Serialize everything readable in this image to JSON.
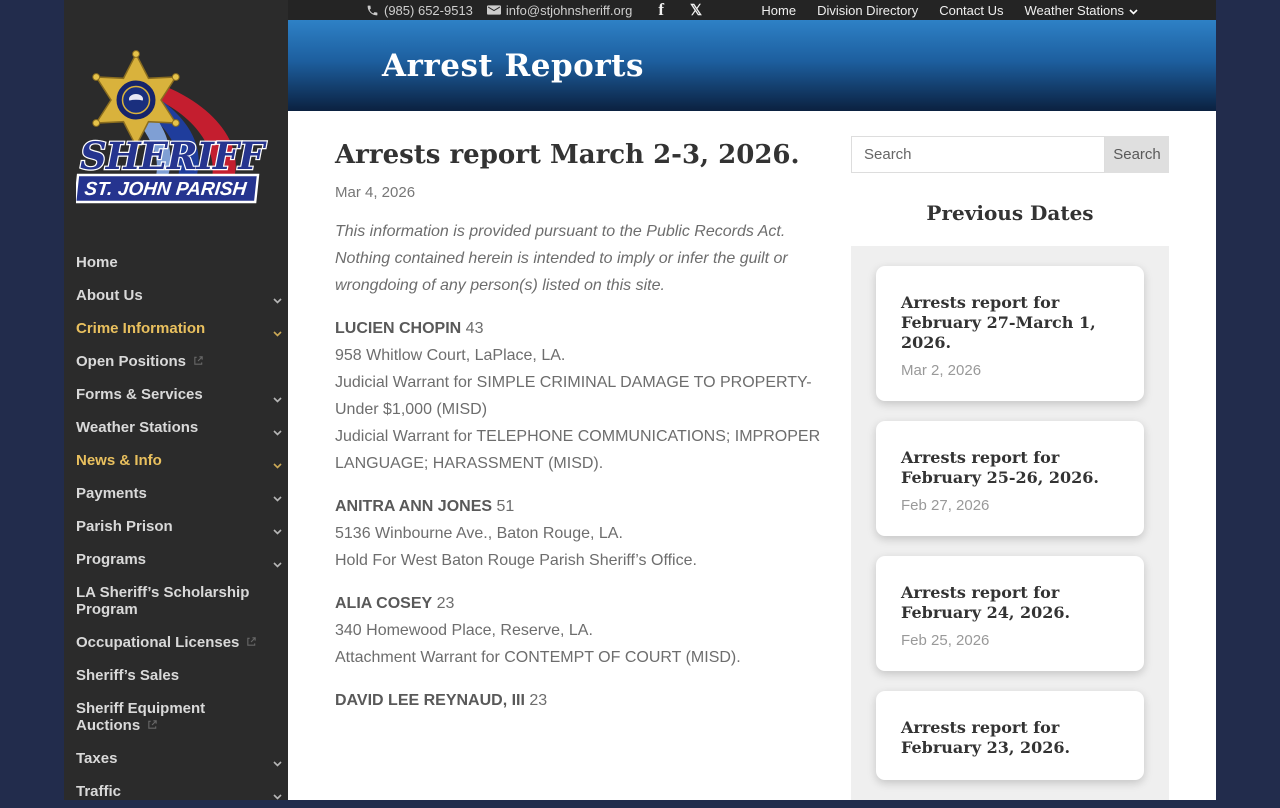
{
  "topbar": {
    "phone": "(985) 652-9513",
    "email": "info@stjohnsheriff.org",
    "nav": [
      {
        "label": "Home",
        "dropdown": false
      },
      {
        "label": "Division Directory",
        "dropdown": false
      },
      {
        "label": "Contact Us",
        "dropdown": false
      },
      {
        "label": "Weather Stations",
        "dropdown": true
      }
    ]
  },
  "logo": {
    "title": "SHERIFF",
    "subtitle": "ST. JOHN PARISH"
  },
  "sidebar": {
    "items": [
      {
        "label": "Home",
        "chevron": false,
        "external": false,
        "active": false
      },
      {
        "label": "About Us",
        "chevron": true,
        "external": false,
        "active": false
      },
      {
        "label": "Crime Information",
        "chevron": true,
        "external": false,
        "active": true
      },
      {
        "label": "Open Positions",
        "chevron": false,
        "external": true,
        "active": false
      },
      {
        "label": "Forms & Services",
        "chevron": true,
        "external": false,
        "active": false
      },
      {
        "label": "Weather Stations",
        "chevron": true,
        "external": false,
        "active": false
      },
      {
        "label": "News & Info",
        "chevron": true,
        "external": false,
        "active": true
      },
      {
        "label": "Payments",
        "chevron": true,
        "external": false,
        "active": false
      },
      {
        "label": "Parish Prison",
        "chevron": true,
        "external": false,
        "active": false
      },
      {
        "label": "Programs",
        "chevron": true,
        "external": false,
        "active": false
      },
      {
        "label": "LA Sheriff’s Scholarship Program",
        "chevron": false,
        "external": false,
        "active": false
      },
      {
        "label": "Occupational Licenses",
        "chevron": false,
        "external": true,
        "active": false
      },
      {
        "label": "Sheriff’s Sales",
        "chevron": false,
        "external": false,
        "active": false
      },
      {
        "label": "Sheriff Equipment Auctions",
        "chevron": false,
        "external": true,
        "active": false
      },
      {
        "label": "Taxes",
        "chevron": true,
        "external": false,
        "active": false
      },
      {
        "label": "Traffic",
        "chevron": true,
        "external": false,
        "active": false
      }
    ]
  },
  "page_header": {
    "title": "Arrest Reports"
  },
  "article": {
    "title": "Arrests report March 2-3, 2026.",
    "date": "Mar 4, 2026",
    "disclaimer": "This information is provided pursuant to the Public Records Act. Nothing contained herein is intended to imply or infer the guilt or wrongdoing of any person(s) listed on this site.",
    "entries": [
      {
        "name": "LUCIEN CHOPIN",
        "age": "43",
        "lines": [
          "958 Whitlow Court, LaPlace, LA.",
          "Judicial Warrant for SIMPLE CRIMINAL DAMAGE TO PROPERTY-Under $1,000 (MISD)",
          "Judicial Warrant for TELEPHONE COMMUNICATIONS; IMPROPER LANGUAGE; HARASSMENT (MISD)."
        ]
      },
      {
        "name": "ANITRA ANN JONES",
        "age": "51",
        "lines": [
          "5136 Winbourne Ave., Baton Rouge, LA.",
          "Hold For West Baton Rouge Parish Sheriff’s Office."
        ]
      },
      {
        "name": "ALIA COSEY",
        "age": "23",
        "lines": [
          "340 Homewood Place, Reserve, LA.",
          "Attachment Warrant for CONTEMPT OF COURT (MISD)."
        ]
      },
      {
        "name": "DAVID LEE REYNAUD, III",
        "age": "23",
        "lines": []
      }
    ]
  },
  "search": {
    "placeholder": "Search",
    "button_label": "Search"
  },
  "previous_dates": {
    "heading": "Previous Dates",
    "cards": [
      {
        "title": "Arrests report for February 27-March 1, 2026.",
        "date": "Mar 2, 2026"
      },
      {
        "title": "Arrests report for February 25-26, 2026.",
        "date": "Feb 27, 2026"
      },
      {
        "title": "Arrests report for February 24, 2026.",
        "date": "Feb 25, 2026"
      },
      {
        "title": "Arrests report for February 23, 2026.",
        "date": ""
      }
    ]
  },
  "colors": {
    "page_background": "#222c4c",
    "sidebar_background": "#2b2b2b",
    "topbar_background": "#242424",
    "active_link_yellow": "#e9c05e",
    "hero_gradient_top": "#2e81c6",
    "hero_gradient_bottom": "#0b2140",
    "body_text_gray": "#6d6d6d",
    "panel_gray": "#efefef"
  }
}
